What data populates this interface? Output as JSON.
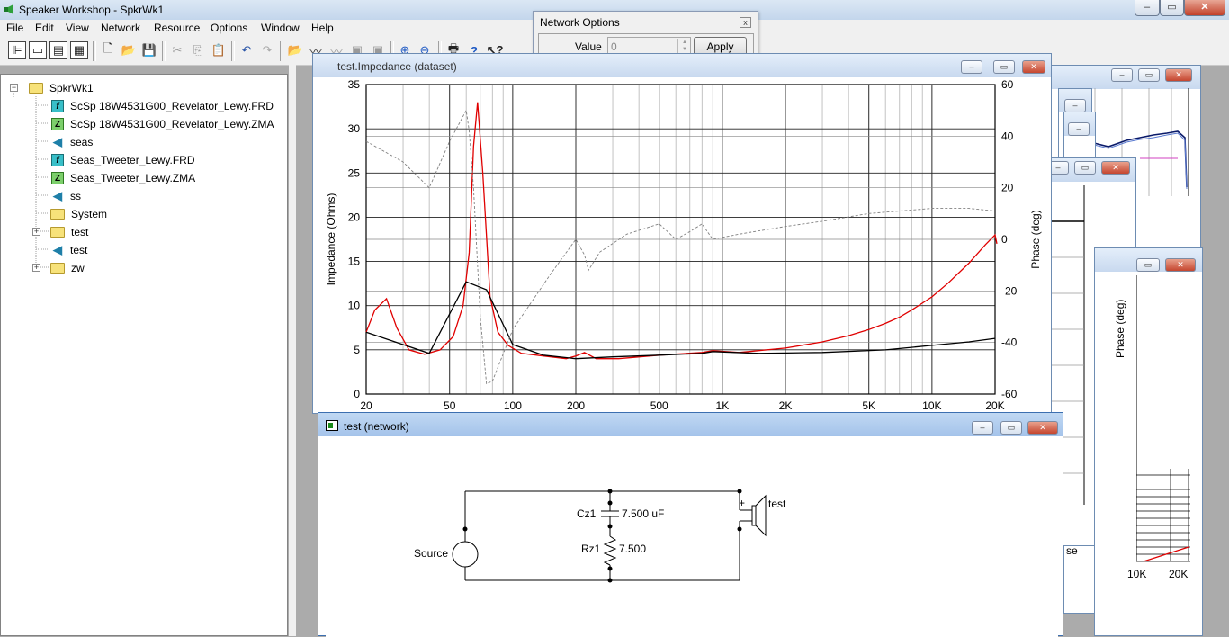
{
  "app": {
    "title": "Speaker Workshop - SpkrWk1"
  },
  "menu": [
    "File",
    "Edit",
    "View",
    "Network",
    "Resource",
    "Options",
    "Window",
    "Help"
  ],
  "network_options": {
    "title": "Network Options",
    "value_label": "Value",
    "value": "0",
    "apply_label": "Apply",
    "close_glyph": "x"
  },
  "tree": {
    "root": "SpkrWk1",
    "items": [
      {
        "label": "ScSp 18W4531G00_Revelator_Lewy.FRD",
        "icon": "frd-file-icon"
      },
      {
        "label": "ScSp 18W4531G00_Revelator_Lewy.ZMA",
        "icon": "zma-file-icon"
      },
      {
        "label": "seas",
        "icon": "speaker-icon"
      },
      {
        "label": "Seas_Tweeter_Lewy.FRD",
        "icon": "frd-file-icon"
      },
      {
        "label": "Seas_Tweeter_Lewy.ZMA",
        "icon": "zma-file-icon"
      },
      {
        "label": "ss",
        "icon": "speaker-icon"
      },
      {
        "label": "System",
        "icon": "folder-icon"
      },
      {
        "label": "test",
        "icon": "folder-icon"
      },
      {
        "label": "test",
        "icon": "speaker-icon"
      },
      {
        "label": "zw",
        "icon": "folder-icon"
      }
    ]
  },
  "impedance_window": {
    "title": "test.Impedance (dataset)"
  },
  "chart_data": {
    "type": "line",
    "xlabel": "",
    "ylabel": "Impedance (Ohms)",
    "y2label": "Phase (deg)",
    "xscale": "log",
    "xlim": [
      20,
      20000
    ],
    "ylim": [
      0,
      35
    ],
    "y2lim": [
      -60,
      60
    ],
    "grid": true,
    "x_ticks": [
      "20",
      "50",
      "100",
      "200",
      "500",
      "1K",
      "2K",
      "5K",
      "10K",
      "20K"
    ],
    "x_tick_values": [
      20,
      50,
      100,
      200,
      500,
      1000,
      2000,
      5000,
      10000,
      20000
    ],
    "y_ticks": [
      "0",
      "5",
      "10",
      "15",
      "20",
      "25",
      "30",
      "35"
    ],
    "y2_ticks": [
      "-60",
      "-40",
      "-20",
      "0",
      "20",
      "40",
      "60"
    ],
    "series": [
      {
        "axis": "y",
        "color": "#e00000",
        "x": [
          20,
          22,
          25,
          28,
          32,
          38,
          45,
          52,
          58,
          62,
          65,
          68,
          72,
          78,
          85,
          95,
          110,
          140,
          180,
          200,
          220,
          250,
          320,
          500,
          800,
          900,
          1200,
          2000,
          3000,
          4000,
          5000,
          6000,
          7000,
          8000,
          10000,
          12000,
          15000,
          18000,
          20000,
          20500
        ],
        "y": [
          7.0,
          9.5,
          10.8,
          7.5,
          5.0,
          4.5,
          5.0,
          6.5,
          10.0,
          16.0,
          28.0,
          33.0,
          25.0,
          11.0,
          7.0,
          5.5,
          4.6,
          4.3,
          4.0,
          4.3,
          4.7,
          4.0,
          4.0,
          4.4,
          4.7,
          4.9,
          4.7,
          5.2,
          5.9,
          6.6,
          7.3,
          8.0,
          8.7,
          9.5,
          11.0,
          12.6,
          14.8,
          16.9,
          18.0,
          17.0
        ]
      },
      {
        "axis": "y",
        "color": "#000000",
        "x": [
          20,
          40,
          60,
          75,
          100,
          140,
          200,
          300,
          500,
          800,
          900,
          1500,
          3000,
          6000,
          10000,
          15000,
          20000
        ],
        "y": [
          7.0,
          4.6,
          12.7,
          11.8,
          5.6,
          4.4,
          4.0,
          4.2,
          4.4,
          4.6,
          4.8,
          4.6,
          4.7,
          5.0,
          5.5,
          5.9,
          6.3
        ]
      },
      {
        "axis": "y2",
        "color": "#808080",
        "dashed": true,
        "x": [
          20,
          30,
          40,
          50,
          60,
          62,
          65,
          70,
          75,
          80,
          100,
          150,
          200,
          220,
          230,
          260,
          350,
          500,
          600,
          700,
          800,
          900,
          1200,
          2000,
          3000,
          5000,
          10000,
          15000,
          20000
        ],
        "y": [
          38,
          30,
          20,
          38,
          50,
          42,
          20,
          -30,
          -56,
          -55,
          -35,
          -14,
          0,
          -6,
          -12,
          -5,
          2,
          6,
          0,
          3,
          6,
          0,
          2,
          5,
          7,
          10,
          12,
          12,
          11
        ]
      }
    ]
  },
  "network_window": {
    "title": "test (network)",
    "source_label": "Source",
    "cap_label": "Cz1",
    "cap_value": "7.500 uF",
    "res_label": "Rz1",
    "res_value": "7.500",
    "speaker_label": "test",
    "plus_sign": "+"
  },
  "background_windows": {
    "phase_label": "Phase (deg)",
    "x_ticks": [
      "10K",
      "20K"
    ],
    "speaker_label_partial": "se"
  }
}
